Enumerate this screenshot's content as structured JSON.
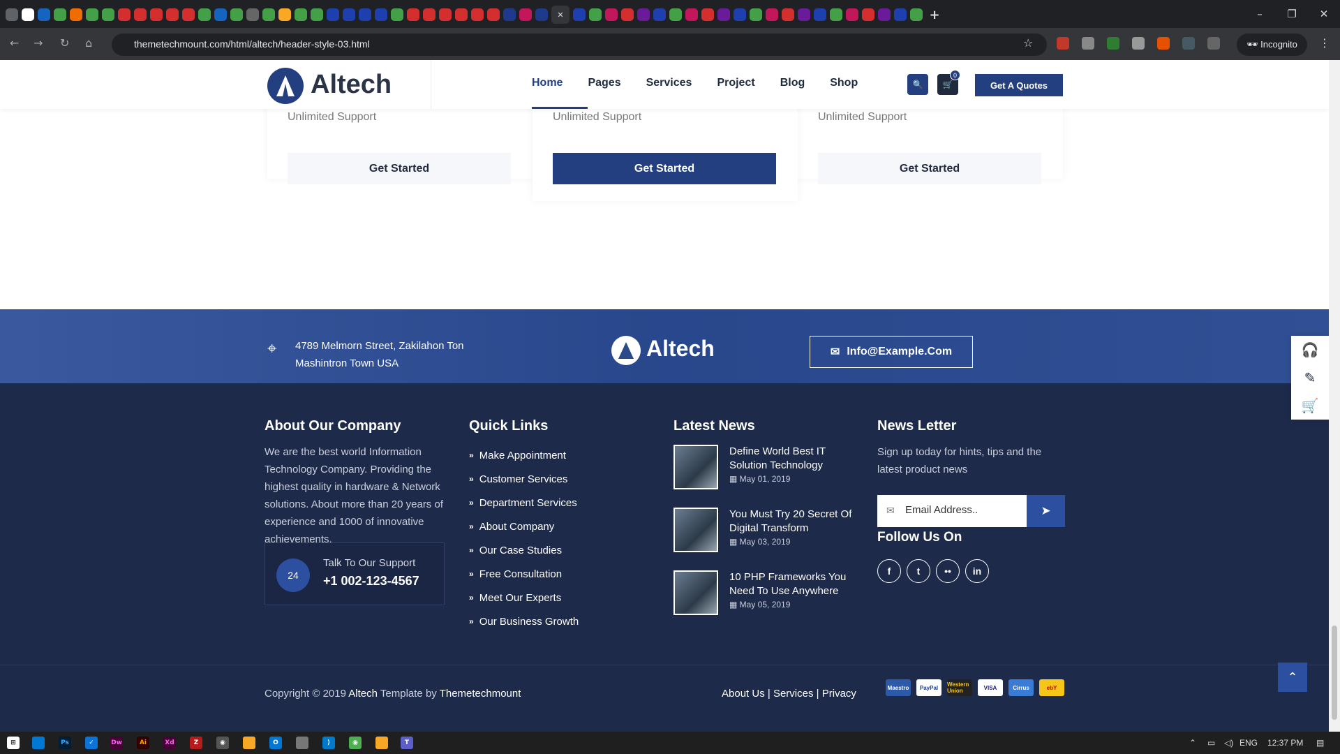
{
  "browser": {
    "url": "themetechmount.com/html/altech/header-style-03.html",
    "mode_label": "Incognito"
  },
  "header": {
    "logo_text": "Altech",
    "menu": [
      "Home",
      "Pages",
      "Services",
      "Project",
      "Blog",
      "Shop"
    ],
    "active_menu": "Home",
    "cart_count": "0",
    "quote_label": "Get A Quotes"
  },
  "pricing": {
    "feature": "Unlimited Support",
    "button_label": "Get Started"
  },
  "banner": {
    "address_line1": "4789 Melmorn Street, Zakilahon Ton",
    "address_line2": "Mashintron Town USA",
    "logo_text": "Altech",
    "email": "Info@Example.Com"
  },
  "footer": {
    "about": {
      "title": "About Our Company",
      "text": "We are the best world Information Technology Company. Providing the highest quality in hardware & Network solutions. About more than 20 years of experience and 1000 of innovative achievements.",
      "support_label": "Talk To Our Support",
      "support_phone": "+1 002-123-4567"
    },
    "quick_links": {
      "title": "Quick Links",
      "items": [
        "Make Appointment",
        "Customer Services",
        "Department Services",
        "About Company",
        "Our Case Studies",
        "Free Consultation",
        "Meet Our Experts",
        "Our Business Growth"
      ]
    },
    "news": {
      "title": "Latest News",
      "items": [
        {
          "title": "Define World Best IT Solution Technology",
          "date": "May 01, 2019"
        },
        {
          "title": "You Must Try 20 Secret Of Digital Transform",
          "date": "May 03, 2019"
        },
        {
          "title": "10 PHP Frameworks You Need To Use Anywhere",
          "date": "May 05, 2019"
        }
      ]
    },
    "newsletter": {
      "title": "News Letter",
      "text": "Sign up today for hints, tips and the latest product news",
      "placeholder": "Email Address..",
      "follow_title": "Follow Us On"
    },
    "copyright_prefix": "Copyright © 2019",
    "copyright_brand": "Altech",
    "copyright_mid": "Template by",
    "copyright_author": "Themetechmount",
    "links": [
      "About Us",
      "Services",
      "Privacy"
    ],
    "payments": [
      "Maestro",
      "PayPal",
      "Western Union",
      "VISA",
      "Cirrus",
      "ebY"
    ]
  },
  "taskbar": {
    "lang": "ENG",
    "time": "12:37 PM"
  },
  "colors": {
    "primary": "#233f7f",
    "footer_bg": "#1e2a4a",
    "banner_bg": "#2a4a8a"
  }
}
